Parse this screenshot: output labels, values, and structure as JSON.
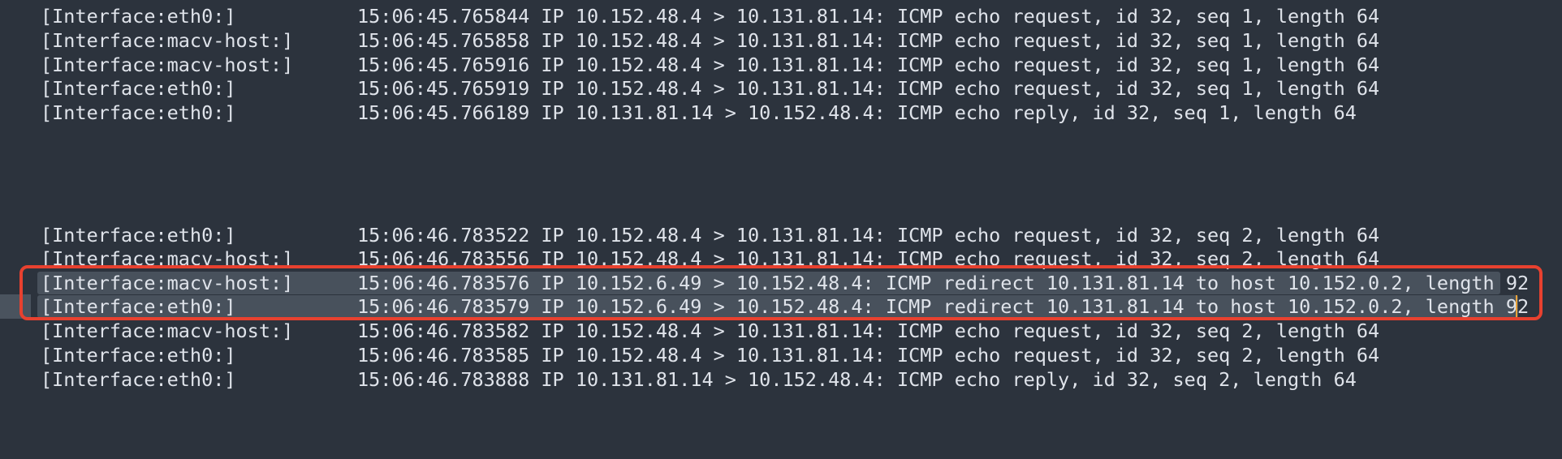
{
  "terminal": {
    "group1": [
      {
        "iface": "[Interface:eth0:]",
        "msg": "15:06:45.765844 IP 10.152.48.4 > 10.131.81.14: ICMP echo request, id 32, seq 1, length 64"
      },
      {
        "iface": "[Interface:macv-host:]",
        "msg": "15:06:45.765858 IP 10.152.48.4 > 10.131.81.14: ICMP echo request, id 32, seq 1, length 64"
      },
      {
        "iface": "[Interface:macv-host:]",
        "msg": "15:06:45.765916 IP 10.152.48.4 > 10.131.81.14: ICMP echo request, id 32, seq 1, length 64"
      },
      {
        "iface": "[Interface:eth0:]",
        "msg": "15:06:45.765919 IP 10.152.48.4 > 10.131.81.14: ICMP echo request, id 32, seq 1, length 64"
      },
      {
        "iface": "[Interface:eth0:]",
        "msg": "15:06:45.766189 IP 10.131.81.14 > 10.152.48.4: ICMP echo reply, id 32, seq 1, length 64"
      }
    ],
    "group2": [
      {
        "iface": "[Interface:eth0:]",
        "msg": "15:06:46.783522 IP 10.152.48.4 > 10.131.81.14: ICMP echo request, id 32, seq 2, length 64"
      },
      {
        "iface": "[Interface:macv-host:]",
        "msg": "15:06:46.783556 IP 10.152.48.4 > 10.131.81.14: ICMP echo request, id 32, seq 2, length 64"
      },
      {
        "iface": "[Interface:macv-host:]",
        "msg": "15:06:46.783576 IP 10.152.6.49 > 10.152.48.4: ICMP redirect 10.131.81.14 to host 10.152.0.2, length 92"
      },
      {
        "iface": "[Interface:eth0:]",
        "msg": "15:06:46.783579 IP 10.152.6.49 > 10.152.48.4: ICMP redirect 10.131.81.14 to host 10.152.0.2, length 92"
      },
      {
        "iface": "[Interface:macv-host:]",
        "msg": "15:06:46.783582 IP 10.152.48.4 > 10.131.81.14: ICMP echo request, id 32, seq 2, length 64"
      },
      {
        "iface": "[Interface:eth0:]",
        "msg": "15:06:46.783585 IP 10.152.48.4 > 10.131.81.14: ICMP echo request, id 32, seq 2, length 64"
      },
      {
        "iface": "[Interface:eth0:]",
        "msg": "15:06:46.783888 IP 10.131.81.14 > 10.152.48.4: ICMP echo reply, id 32, seq 2, length 64"
      }
    ],
    "colors": {
      "background": "#2c333d",
      "text": "#dfe3ea",
      "selection": "#48515c",
      "highlight_border": "#e8412f",
      "cursor": "#e8a23a"
    }
  }
}
